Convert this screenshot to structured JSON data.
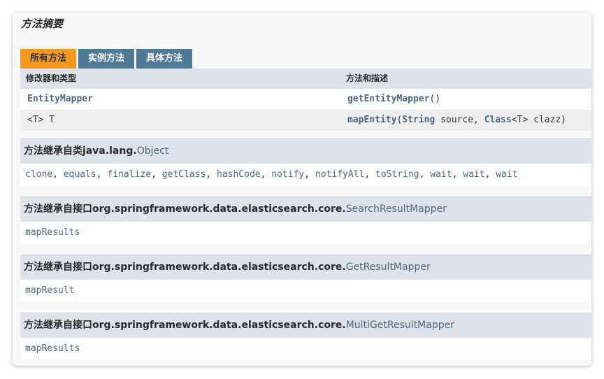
{
  "summary_title": "方法摘要",
  "tabs": [
    {
      "label": "所有方法",
      "active": true
    },
    {
      "label": "实例方法",
      "active": false
    },
    {
      "label": "具体方法",
      "active": false
    }
  ],
  "table": {
    "headers": [
      "修改器和类型",
      "方法和描述"
    ],
    "rows": [
      {
        "type": "EntityMapper",
        "method_name": "getEntityMapper",
        "method_rest": "()"
      },
      {
        "type": "<T> T",
        "method_name": "mapEntity",
        "param1_open": "(",
        "param1_type": "String",
        "param1_name": " source, ",
        "param2_type": "Class",
        "param2_rest": "<T> clazz)"
      }
    ]
  },
  "inherited": [
    {
      "prefix": "方法继承自类java.lang.",
      "class_name": "Object",
      "methods": [
        "clone",
        "equals",
        "finalize",
        "getClass",
        "hashCode",
        "notify",
        "notifyAll",
        "toString",
        "wait",
        "wait",
        "wait"
      ]
    },
    {
      "prefix": "方法继承自接口org.springframework.data.elasticsearch.core.",
      "class_name": "SearchResultMapper",
      "methods": [
        "mapResults"
      ]
    },
    {
      "prefix": "方法继承自接口org.springframework.data.elasticsearch.core.",
      "class_name": "GetResultMapper",
      "methods": [
        "mapResult"
      ]
    },
    {
      "prefix": "方法继承自接口org.springframework.data.elasticsearch.core.",
      "class_name": "MultiGetResultMapper",
      "methods": [
        "mapResults"
      ]
    }
  ],
  "colors": {
    "active_tab": "#f8981d",
    "tab": "#4d7a97",
    "header_bg": "#dee3e9",
    "link": "#4a6782"
  }
}
